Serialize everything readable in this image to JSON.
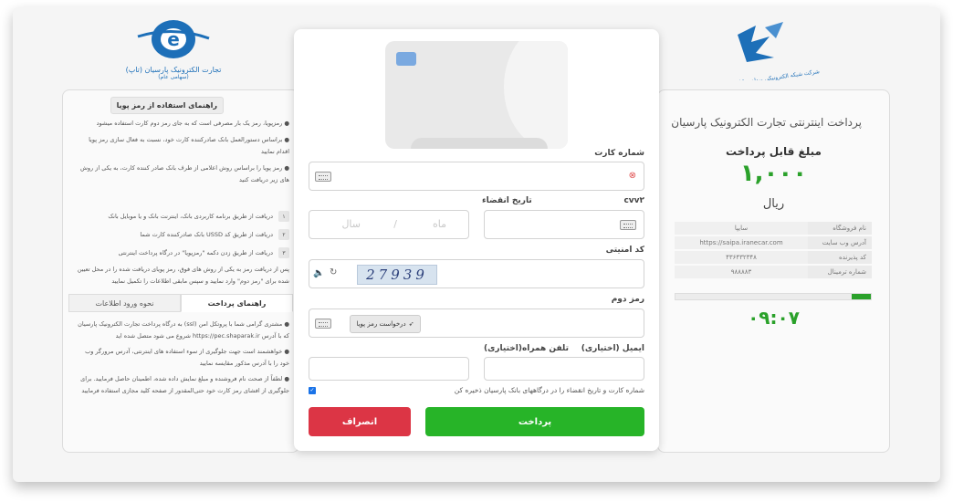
{
  "header": {
    "shaparak_logo_text": "شرکت شبکه الکترونیکی پرداخت کارت (شاپرک)",
    "pec_name": "تجارت الکترونیک پارسیان (تاپ)",
    "pec_sub": "(سهامی عام)"
  },
  "info": {
    "title": "پرداخت اینترنتی تجارت الکترونیک پارسیان",
    "amount_label": "مبلغ قابل پرداخت",
    "amount": "۱,۰۰۰",
    "currency": "ریال",
    "rows": [
      {
        "key": "نام فروشگاه",
        "value": "سایپا"
      },
      {
        "key": "آدرس وب سایت",
        "value": "https://saipa.iranecar.com"
      },
      {
        "key": "کد پذیرنده",
        "value": "۴۳۶۴۳۲۳۴۸"
      },
      {
        "key": "شماره ترمینال",
        "value": "۹۸۸۸۸۳"
      }
    ],
    "progress": 0.1,
    "timer": "۰۹:۰۷"
  },
  "help": {
    "title": "راهنمای استفاده از رمز پویا",
    "items": [
      "رمزپویا، رمز یک بار مصرفی است که به جای رمز دوم کارت استفاده میشود",
      "براساس دستورالعمل بانک صادرکننده کارت خود، نسبت به فعال سازی رمز پویا اقدام نمایید",
      "رمز پویا را براساس روش اعلامی از طرف بانک صادر کننده کارت، به یکی از روش های زیر دریافت کنید"
    ],
    "steps": [
      {
        "num": "۱",
        "text": "دریافت از طریق برنامه کاربردی بانک، اینترنت بانک و یا موبایل بانک"
      },
      {
        "num": "۲",
        "text": "دریافت از طریق کد USSD بانک صادرکننده کارت شما"
      },
      {
        "num": "۳",
        "text": "دریافت از طریق زدن دکمه \"رمزپویا\" در درگاه پرداخت اینترنتی"
      }
    ],
    "after": "پس از دریافت رمز به یکی از روش های فوق، رمز پویای دریافت شده را در محل تعیین شده برای \"رمز دوم\" وارد نمایید و سپس مابقی اطلاعات را تکمیل نمایید",
    "tab_active": "راهنمای پرداخت",
    "tab_inactive": "نحوه ورود اطلاعات",
    "guide": [
      "مشتری گرامی شما با پروتکل امن (ssl) به درگاه پرداخت تجارت الکترونیک پارسیان که با آدرس https://pec.shaparak.ir شروع می شود متصل شده اید",
      "خواهشمند است جهت جلوگیری از سوء استفاده های اینترنتی، آدرس مرورگر وب خود را با آدرس مذکور مقایسه نمایید",
      "لطفاً از صحت نام فروشنده و مبلغ نمایش داده شده، اطمینان حاصل فرمایید. برای جلوگیری از افشای رمز کارت خود حتی‌المقدور از صفحه کلید مجازی استفاده فرمایید"
    ]
  },
  "form": {
    "card_label": "شماره کارت",
    "cvv_label": "cvv۲",
    "expiry_label": "تاریخ انقضاء",
    "month_placeholder": "ماه",
    "year_placeholder": "سال",
    "captcha_label": "کد امنیتی",
    "captcha_text": "27939",
    "pin_label": "رمز دوم",
    "otp_button": "درخواست رمز پویا",
    "email_label": "ایمیل (اختیاری)",
    "mobile_label": "تلفن همراه(اختیاری)",
    "save_text": "شماره کارت و تاریخ انقضاء را در درگاههای بانک پارسیان ذخیره کن",
    "pay_button": "پرداخت",
    "cancel_button": "انصراف"
  },
  "colors": {
    "green": "#2aa12a",
    "red": "#dc3545",
    "pay_green": "#27b428",
    "pec_blue": "#1d6fb8"
  }
}
